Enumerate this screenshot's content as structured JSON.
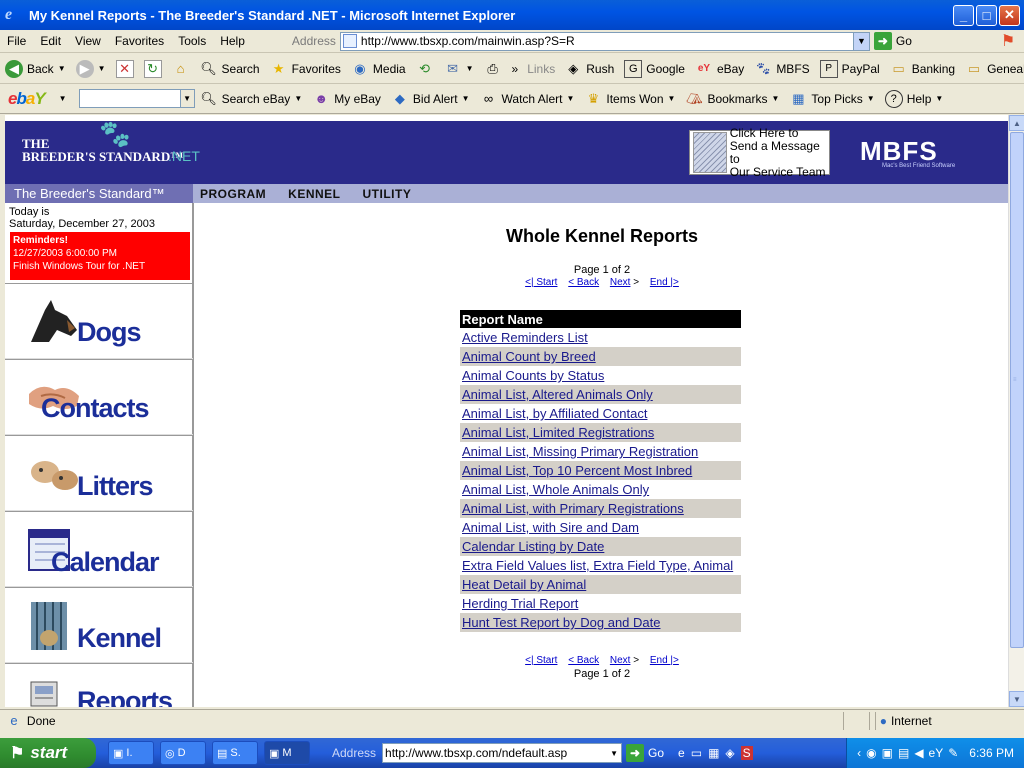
{
  "window": {
    "title": "My Kennel Reports - The Breeder's Standard .NET - Microsoft Internet Explorer"
  },
  "menubar": {
    "items": [
      "File",
      "Edit",
      "View",
      "Favorites",
      "Tools",
      "Help"
    ],
    "address_label": "Address",
    "url": "http://www.tbsxp.com/mainwin.asp?S=R",
    "go_label": "Go"
  },
  "toolbar": {
    "back": "Back",
    "search": "Search",
    "favorites": "Favorites",
    "media": "Media",
    "links_label": "Links",
    "links": [
      "Rush",
      "Google",
      "eBay",
      "MBFS",
      "PayPal",
      "Banking",
      "Genealogy"
    ]
  },
  "ebaybar": {
    "search_ebay": "Search eBay",
    "my_ebay": "My eBay",
    "bid_alert": "Bid Alert",
    "watch_alert": "Watch Alert",
    "items_won": "Items Won",
    "bookmarks": "Bookmarks",
    "top_picks": "Top Picks",
    "help": "Help"
  },
  "site": {
    "logo_line1": "THE",
    "logo_line2": "BREEDER'S STANDARD™",
    "logo_net": ".NET",
    "message_box": [
      "Click Here to",
      "Send a Message to",
      "Our Service Team"
    ],
    "mbfs_logo": "MBFS",
    "mbfs_tagline": "Mac's Best Friend Software",
    "left_header": "The Breeder's Standard™",
    "program_menu": [
      "PROGRAM",
      "KENNEL",
      "UTILITY"
    ],
    "today_label": "Today is",
    "today_date": "Saturday, December 27, 2003",
    "reminders": {
      "title": "Reminders!",
      "time": "12/27/2003 6:00:00 PM",
      "text": "Finish Windows Tour for .NET"
    },
    "nav": [
      {
        "label": "Dogs"
      },
      {
        "label": "Contacts"
      },
      {
        "label": "Litters"
      },
      {
        "label": "Calendar"
      },
      {
        "label": "Kennel"
      },
      {
        "label": "Reports"
      }
    ]
  },
  "report": {
    "title": "Whole Kennel Reports",
    "page_info": "Page 1 of 2",
    "pager": {
      "start": "<| Start",
      "back": "< Back",
      "next": "Next",
      "next_arrow": ">",
      "end": "End |>"
    },
    "column_header": "Report Name",
    "rows": [
      "Active Reminders List",
      "Animal Count by Breed",
      "Animal Counts by Status",
      "Animal List, Altered Animals Only",
      "Animal List, by Affiliated Contact",
      "Animal List, Limited Registrations",
      "Animal List, Missing Primary Registration",
      "Animal List, Top 10 Percent Most Inbred",
      "Animal List, Whole Animals Only",
      "Animal List, with Primary Registrations",
      "Animal List, with Sire and Dam",
      "Calendar Listing by Date",
      "Extra Field Values list, Extra Field Type, Animal",
      "Heat Detail by Animal",
      "Herding Trial Report",
      "Hunt Test Report by Dog and Date"
    ]
  },
  "statusbar": {
    "status": "Done",
    "zone": "Internet"
  },
  "taskbar": {
    "start": "start",
    "tasks": [
      "I.",
      "D",
      "S.",
      "M"
    ],
    "address_label": "Address",
    "address_url": "http://www.tbsxp.com/ndefault.asp",
    "go": "Go",
    "clock": "6:36 PM"
  }
}
